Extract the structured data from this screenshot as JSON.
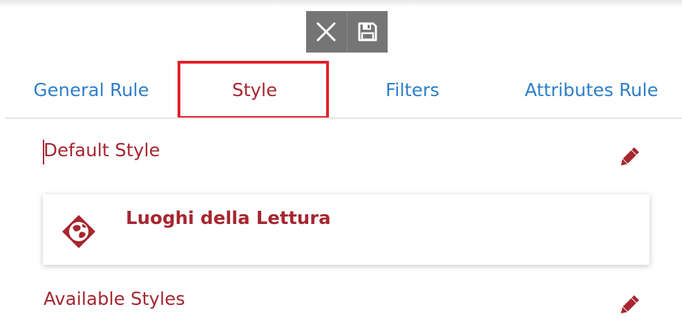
{
  "toolbar": {
    "close_icon": "close-icon",
    "save_icon": "floppy-disk-icon"
  },
  "tabs": [
    {
      "label": "General Rule",
      "active": false
    },
    {
      "label": "Style",
      "active": true
    },
    {
      "label": "Filters",
      "active": false
    },
    {
      "label": "Attributes Rule",
      "active": false
    }
  ],
  "default_style": {
    "label": "Default Style",
    "edit_icon": "pencil-icon",
    "selected": {
      "name": "Luoghi della Lettura",
      "icon": "globe-layer-icon"
    }
  },
  "available_styles": {
    "label": "Available Styles",
    "edit_icon": "pencil-icon"
  },
  "colors": {
    "accent": "#a6262f",
    "tab_inactive": "#2f7fc8",
    "highlight": "#e31e2a",
    "toolbar_bg": "#757575"
  }
}
